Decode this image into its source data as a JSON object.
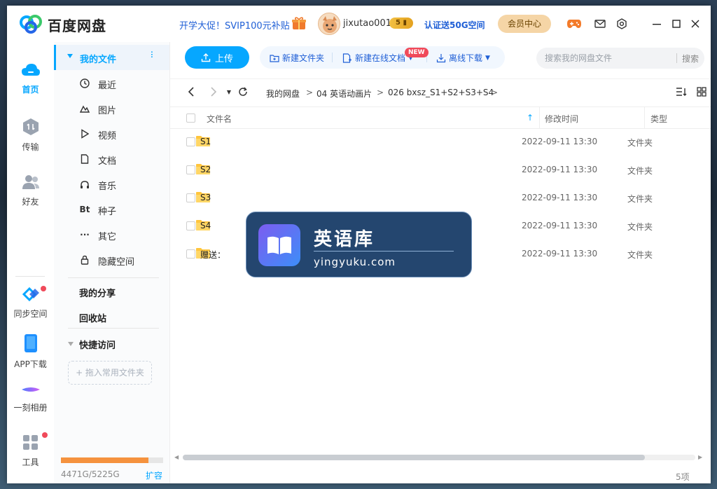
{
  "app": {
    "title": "百度网盘",
    "promo": "开学大促！SVIP100元补贴",
    "username": "jixutao001",
    "level": "5",
    "verify": "认证送50G空间",
    "vip_center": "会员中心"
  },
  "leftnav": {
    "home": "首页",
    "transfer": "传输",
    "friends": "好友",
    "sync": "同步空间",
    "app_download": "APP下载",
    "album": "一刻相册",
    "tools": "工具"
  },
  "sidebar": {
    "my_files": "我的文件",
    "items": [
      {
        "label": "最近",
        "icon": "clock-icon"
      },
      {
        "label": "图片",
        "icon": "image-icon"
      },
      {
        "label": "视频",
        "icon": "play-icon"
      },
      {
        "label": "文档",
        "icon": "document-icon"
      },
      {
        "label": "音乐",
        "icon": "headphones-icon"
      },
      {
        "label": "种子",
        "icon": "bt-icon",
        "glyph": "Bt"
      },
      {
        "label": "其它",
        "icon": "more-icon",
        "glyph": "···"
      },
      {
        "label": "隐藏空间",
        "icon": "lock-icon"
      }
    ],
    "my_share": "我的分享",
    "recycle": "回收站",
    "quick_access": "快捷访问",
    "drop_hint": "+ 拖入常用文件夹",
    "quota_text": "4471G/5225G",
    "quota_fraction": 0.856,
    "expand": "扩容"
  },
  "toolbar": {
    "upload": "上传",
    "new_folder": "新建文件夹",
    "new_doc": "新建在线文档",
    "new_badge": "NEW",
    "offline": "离线下载",
    "search_placeholder": "搜索我的网盘文件",
    "search_btn": "搜索"
  },
  "breadcrumb": [
    "我的网盘",
    "04 英语动画片",
    "026 bxsz_S1+S2+S3+S4"
  ],
  "table": {
    "headers": {
      "name": "文件名",
      "time": "修改时间",
      "type": "类型"
    },
    "rows": [
      {
        "name": "S1",
        "time": "2022-09-11 13:30",
        "type": "文件夹"
      },
      {
        "name": "S2",
        "time": "2022-09-11 13:30",
        "type": "文件夹"
      },
      {
        "name": "S3",
        "time": "2022-09-11 13:30",
        "type": "文件夹"
      },
      {
        "name": "S4",
        "time": "2022-09-11 13:30",
        "type": "文件夹"
      },
      {
        "name": "赠送：",
        "time": "2022-09-11 13:30",
        "type": "文件夹"
      }
    ]
  },
  "item_count": "5项",
  "watermark": {
    "title": "英语库",
    "url": "yingyuku.com"
  },
  "colors": {
    "accent": "#06a7ff",
    "link": "#1f5fd6",
    "folder": "#ffc53d",
    "quota": "#f5923e"
  }
}
